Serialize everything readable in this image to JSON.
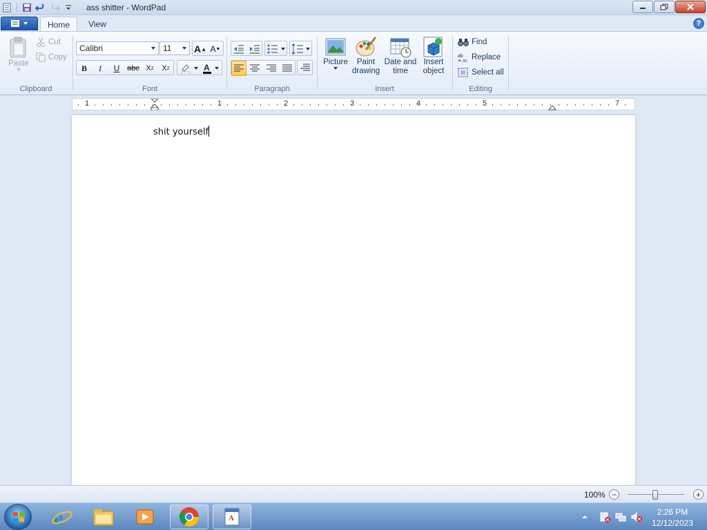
{
  "window": {
    "title": "ass shitter - WordPad"
  },
  "tabs": [
    {
      "label": "Home",
      "selected": true
    },
    {
      "label": "View",
      "selected": false
    }
  ],
  "ribbon": {
    "clipboard": {
      "group_label": "Clipboard",
      "paste_label": "Paste",
      "cut_label": "Cut",
      "copy_label": "Copy"
    },
    "font": {
      "group_label": "Font",
      "family": "Calibri",
      "size": "11",
      "bold": "B",
      "italic": "I",
      "underline": "U",
      "strikethrough": "abc"
    },
    "paragraph": {
      "group_label": "Paragraph"
    },
    "insert": {
      "group_label": "Insert",
      "picture_label": "Picture",
      "paint_label_1": "Paint",
      "paint_label_2": "drawing",
      "datetime_label_1": "Date and",
      "datetime_label_2": "time",
      "object_label_1": "Insert",
      "object_label_2": "object"
    },
    "editing": {
      "group_label": "Editing",
      "find_label": "Find",
      "replace_label": "Replace",
      "selectall_label": "Select all"
    }
  },
  "ruler": {
    "numbers": [
      "1",
      "1",
      "2",
      "3",
      "4",
      "5",
      "7"
    ]
  },
  "document": {
    "text": "shit yourself"
  },
  "status": {
    "zoom": "100%"
  },
  "taskbar": {
    "time": "2:26 PM",
    "date": "12/12/2023"
  }
}
